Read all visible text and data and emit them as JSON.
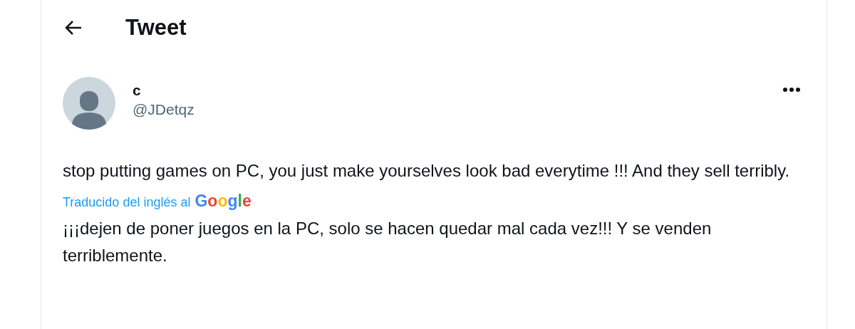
{
  "header": {
    "title": "Tweet"
  },
  "tweet": {
    "display_name": "c",
    "handle": "@JDetqz",
    "text": "stop putting games on PC, you just make yourselves look bad everytime !!! And they sell terribly.",
    "translation_note": "Traducido del inglés al",
    "translator": "Google",
    "translated_text": "¡¡¡dejen de poner juegos en la PC, solo se hacen quedar mal cada vez!!! Y se venden terriblemente."
  }
}
